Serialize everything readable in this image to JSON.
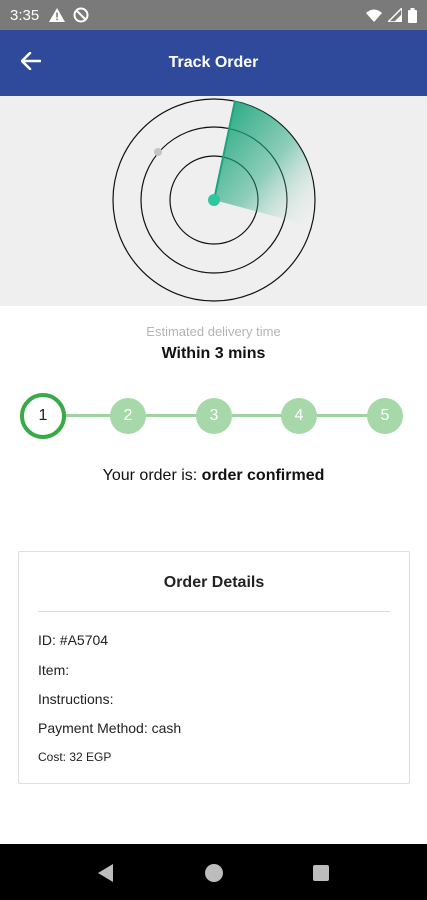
{
  "status_bar": {
    "time": "3:35",
    "icons": [
      "warning-icon",
      "sync-off-icon",
      "wifi-icon",
      "signal-icon",
      "battery-icon"
    ]
  },
  "app_bar": {
    "title": "Track Order",
    "back_icon": "arrow-left-icon"
  },
  "colors": {
    "app_bar": "#2f4a9a",
    "accent_green": "#1aa57a",
    "step_active": "#3aa947",
    "step_inactive": "#a6d8a9"
  },
  "delivery": {
    "label": "Estimated delivery time",
    "value": "Within 3 mins"
  },
  "stepper": {
    "steps": [
      "1",
      "2",
      "3",
      "4",
      "5"
    ],
    "current_step": 1
  },
  "order_status": {
    "prefix": "Your order is:",
    "status": "order confirmed"
  },
  "order_details": {
    "title": "Order Details",
    "id": "ID: #A5704",
    "item": "Item:",
    "instructions": "Instructions:",
    "payment_method": "Payment Method: cash",
    "cost": "Cost: 32 EGP"
  },
  "nav_bar": {
    "icons": [
      "back-triangle-icon",
      "home-circle-icon",
      "recents-square-icon"
    ]
  }
}
